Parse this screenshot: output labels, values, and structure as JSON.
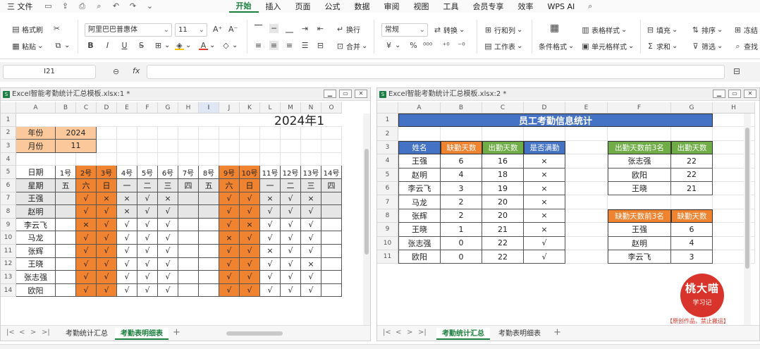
{
  "menubar": {
    "file": "三 文件",
    "tabs": [
      "开始",
      "插入",
      "页面",
      "公式",
      "数据",
      "审阅",
      "视图",
      "工具",
      "会员专享",
      "效率"
    ],
    "active": "开始",
    "ai": "WPS AI"
  },
  "ribbon": {
    "format_painter": "格式刷",
    "paste": "粘贴",
    "font_name": "阿里巴巴普惠体",
    "font_size": "11",
    "bold": "B",
    "italic": "I",
    "underline": "U",
    "wrap": "换行",
    "merge": "合并",
    "number_format": "常规",
    "convert": "转换",
    "row_col": "行和列",
    "worksheet": "工作表",
    "cond_format": "条件格式",
    "table_style": "表格样式",
    "cell_style": "单元格样式",
    "fill": "填充",
    "sort": "排序",
    "freeze": "冻结",
    "sum": "求和",
    "filter": "筛选",
    "find": "查找"
  },
  "formula": {
    "name_box": "I21",
    "fx": "fx"
  },
  "colors": {
    "orange": "#f0832f",
    "peach": "#fbc89b",
    "gray_cell": "#e6e6e6",
    "title_blue": "#4472c4",
    "header_blue": "#4472c4",
    "header_green": "#70ad47",
    "accent_green": "#1a7f3c",
    "stamp_red": "#d9342b"
  },
  "left": {
    "title": "Excel智能考勤统计汇总模板.xlsx:1 *",
    "columns": [
      "A",
      "B",
      "C",
      "D",
      "E",
      "F",
      "G",
      "H",
      "I",
      "J",
      "K",
      "L",
      "M",
      "N",
      "O"
    ],
    "rows": [
      "1",
      "2",
      "3",
      "4",
      "5",
      "6",
      "7",
      "8",
      "9",
      "10",
      "11",
      "12",
      "13",
      "14"
    ],
    "banner": "2024年1",
    "year_label": "年份",
    "year_value": "2024",
    "month_label": "月份",
    "month_value": "11",
    "date_label": "日期",
    "week_label": "星期",
    "days": [
      "1号",
      "2号",
      "3号",
      "4号",
      "5号",
      "6号",
      "7号",
      "8号",
      "9号",
      "10号",
      "11号",
      "12号",
      "13号",
      "14号"
    ],
    "weekdays": [
      "五",
      "六",
      "日",
      "一",
      "二",
      "三",
      "四",
      "五",
      "六",
      "日",
      "一",
      "二",
      "三",
      "四"
    ],
    "employees": [
      {
        "name": "王强",
        "marks": [
          "",
          "√",
          "×",
          "×",
          "√",
          "×",
          "",
          "",
          "√",
          "√",
          "×",
          "√",
          "×",
          ""
        ]
      },
      {
        "name": "赵明",
        "marks": [
          "",
          "√",
          "√",
          "×",
          "√",
          "√",
          "",
          "",
          "√",
          "√",
          "√",
          "√",
          "√",
          ""
        ]
      },
      {
        "name": "李云飞",
        "marks": [
          "",
          "×",
          "√",
          "√",
          "√",
          "√",
          "",
          "",
          "√",
          "×",
          "√",
          "√",
          "√",
          ""
        ]
      },
      {
        "name": "马龙",
        "marks": [
          "",
          "√",
          "√",
          "√",
          "√",
          "√",
          "",
          "",
          "×",
          "√",
          "√",
          "√",
          "√",
          ""
        ]
      },
      {
        "name": "张辉",
        "marks": [
          "",
          "√",
          "√",
          "√",
          "√",
          "√",
          "",
          "",
          "√",
          "√",
          "×",
          "√",
          "√",
          ""
        ]
      },
      {
        "name": "王晓",
        "marks": [
          "",
          "√",
          "√",
          "√",
          "√",
          "√",
          "",
          "",
          "√",
          "√",
          "√",
          "√",
          "×",
          ""
        ]
      },
      {
        "name": "张志强",
        "marks": [
          "",
          "√",
          "√",
          "√",
          "√",
          "√",
          "",
          "",
          "√",
          "√",
          "√",
          "√",
          "√",
          ""
        ]
      },
      {
        "name": "欧阳",
        "marks": [
          "",
          "√",
          "√",
          "√",
          "√",
          "√",
          "",
          "",
          "√",
          "√",
          "√",
          "√",
          "√",
          ""
        ]
      }
    ],
    "tabs": [
      "考勤统计汇总",
      "考勤表明细表"
    ],
    "active_tab": "考勤表明细表"
  },
  "right": {
    "title": "Excel智能考勤统计汇总模板.xlsx:2 *",
    "columns": [
      "A",
      "B",
      "C",
      "D",
      "E",
      "F",
      "G",
      "H"
    ],
    "rows": [
      "1",
      "2",
      "3",
      "4",
      "5",
      "6",
      "7",
      "8",
      "9",
      "10",
      "11"
    ],
    "main_title": "员工考勤信息统计",
    "headers": [
      "姓名",
      "缺勤天数",
      "出勤天数",
      "是否满勤"
    ],
    "records": [
      [
        "王强",
        "6",
        "16",
        "×"
      ],
      [
        "赵明",
        "4",
        "18",
        "×"
      ],
      [
        "李云飞",
        "3",
        "19",
        "×"
      ],
      [
        "马龙",
        "2",
        "20",
        "×"
      ],
      [
        "张辉",
        "2",
        "20",
        "×"
      ],
      [
        "王晓",
        "1",
        "21",
        "×"
      ],
      [
        "张志强",
        "0",
        "22",
        "√"
      ],
      [
        "欧阳",
        "0",
        "22",
        "√"
      ]
    ],
    "top_present": {
      "header": [
        "出勤天数前3名",
        "出勤天数"
      ],
      "rows": [
        [
          "张志强",
          "22"
        ],
        [
          "欧阳",
          "22"
        ],
        [
          "王晓",
          "21"
        ]
      ]
    },
    "top_absent": {
      "header": [
        "缺勤天数前3名",
        "缺勤天数"
      ],
      "rows": [
        [
          "王强",
          "6"
        ],
        [
          "赵明",
          "4"
        ],
        [
          "李云飞",
          "3"
        ]
      ]
    },
    "tabs": [
      "考勤统计汇总",
      "考勤表明细表"
    ],
    "active_tab": "考勤统计汇总",
    "stamp": {
      "line1": "桃大喵",
      "line2": "学习记",
      "caption": "【原创作品，禁止搬运】"
    }
  }
}
